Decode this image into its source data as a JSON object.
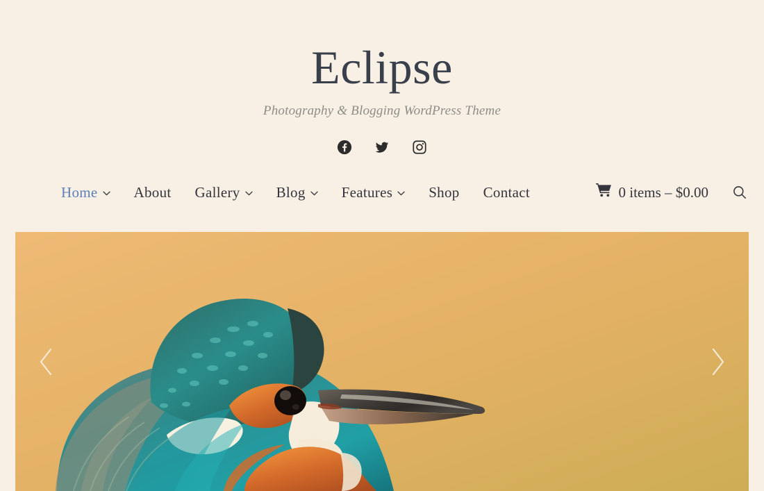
{
  "header": {
    "site_title": "Eclipse",
    "tagline": "Photography & Blogging WordPress Theme"
  },
  "social": {
    "items": [
      {
        "name": "facebook-icon",
        "label": "Facebook"
      },
      {
        "name": "twitter-icon",
        "label": "Twitter"
      },
      {
        "name": "instagram-icon",
        "label": "Instagram"
      }
    ]
  },
  "nav": {
    "items": [
      {
        "label": "Home",
        "has_submenu": true,
        "current": true
      },
      {
        "label": "About",
        "has_submenu": false,
        "current": false
      },
      {
        "label": "Gallery",
        "has_submenu": true,
        "current": false
      },
      {
        "label": "Blog",
        "has_submenu": true,
        "current": false
      },
      {
        "label": "Features",
        "has_submenu": true,
        "current": false
      },
      {
        "label": "Shop",
        "has_submenu": false,
        "current": false
      },
      {
        "label": "Contact",
        "has_submenu": false,
        "current": false
      }
    ],
    "cart": {
      "icon": "shopping-cart-icon",
      "text": "0 items – $0.00",
      "items_count": "0",
      "total": "$0.00"
    },
    "search": {
      "icon": "search-icon",
      "label": "Search"
    }
  },
  "hero": {
    "image_alt": "Common kingfisher perched, close-up portrait against golden background",
    "prev_label": "Previous slide",
    "next_label": "Next slide",
    "prev_icon": "chevron-left-icon",
    "next_icon": "chevron-right-icon"
  },
  "colors": {
    "page_background": "#f8f0e4",
    "title_text": "#39404c",
    "tagline_text": "#8d8d87",
    "nav_text": "#34343c",
    "nav_current": "#5c80b8",
    "hero_background": "#e7b469",
    "arrow": "#f7efe2"
  }
}
